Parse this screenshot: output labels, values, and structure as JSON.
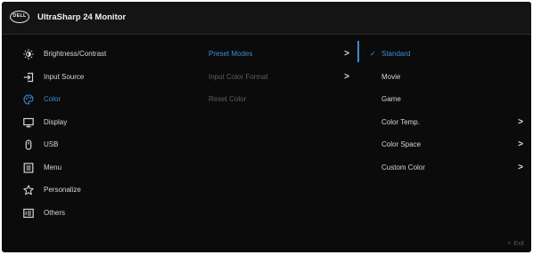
{
  "header": {
    "logo_text": "DELL",
    "model": "UltraSharp 24 Monitor"
  },
  "main_menu": {
    "items": [
      {
        "label": "Brightness/Contrast",
        "icon": "brightness-icon"
      },
      {
        "label": "Input Source",
        "icon": "input-source-icon"
      },
      {
        "label": "Color",
        "icon": "color-palette-icon"
      },
      {
        "label": "Display",
        "icon": "display-icon"
      },
      {
        "label": "USB",
        "icon": "usb-icon"
      },
      {
        "label": "Menu",
        "icon": "menu-icon"
      },
      {
        "label": "Personalize",
        "icon": "star-icon"
      },
      {
        "label": "Others",
        "icon": "others-icon"
      }
    ],
    "active_index": 2
  },
  "color_submenu": {
    "items": [
      {
        "label": "Preset Modes",
        "chevron": ">"
      },
      {
        "label": "Input Color Format",
        "chevron": ">"
      },
      {
        "label": "Reset Color",
        "chevron": ""
      }
    ],
    "selected_index": 0
  },
  "preset_modes": {
    "check_mark": "✓",
    "items": [
      {
        "label": "Standard",
        "chevron": ""
      },
      {
        "label": "Movie",
        "chevron": ""
      },
      {
        "label": "Game",
        "chevron": ""
      },
      {
        "label": "Color Temp.",
        "chevron": ">"
      },
      {
        "label": "Color Space",
        "chevron": ">"
      },
      {
        "label": "Custom Color",
        "chevron": ">"
      }
    ],
    "current_index": 0
  },
  "footer": {
    "exit_symbol": "<",
    "exit_label": "Exit"
  },
  "colors": {
    "background": "#0b0b0b",
    "accent": "#3d8bd9",
    "text": "#d6d6d6",
    "dim_text": "#5e5e5e"
  }
}
